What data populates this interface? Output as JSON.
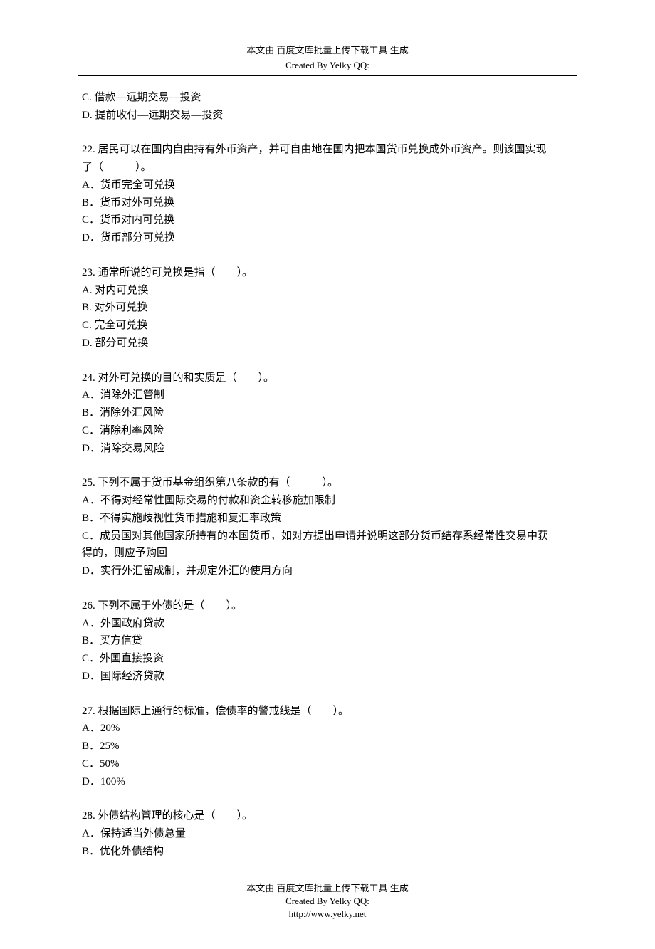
{
  "header": {
    "line1": "本文由  百度文库批量上传下载工具  生成",
    "line2": "Created By Yelky QQ:"
  },
  "prev": {
    "optC": "C. 借款—远期交易—投资",
    "optD": "D. 提前收付—远期交易—投资"
  },
  "q22": {
    "stem1": "22. 居民可以在国内自由持有外币资产，并可自由地在国内把本国货币兑换成外币资产。则该国实现",
    "stem2": "了（　　　）。",
    "a": "A．货币完全可兑换",
    "b": "B．货币对外可兑换",
    "c": "C．货币对内可兑换",
    "d": "D．货币部分可兑换"
  },
  "q23": {
    "stem": "23. 通常所说的可兑换是指（　　）。",
    "a": "A. 对内可兑换",
    "b": "B. 对外可兑换",
    "c": "C. 完全可兑换",
    "d": "D. 部分可兑换"
  },
  "q24": {
    "stem": "24. 对外可兑换的目的和实质是（　　）。",
    "a": "A．消除外汇管制",
    "b": "B．消除外汇风险",
    "c": "C．消除利率风险",
    "d": "D．消除交易风险"
  },
  "q25": {
    "stem": "25. 下列不属于货币基金组织第八条款的有（　　　）。",
    "a": "A．不得对经常性国际交易的付款和资金转移施加限制",
    "b": "B．不得实施歧视性货币措施和复汇率政策",
    "c1": "C．成员国对其他国家所持有的本国货币，如对方提出申请并说明这部分货币结存系经常性交易中获",
    "c2": "得的，则应予购回",
    "d": "D．实行外汇留成制，并规定外汇的使用方向"
  },
  "q26": {
    "stem": "26. 下列不属于外债的是（　　）。",
    "a": "A．外国政府贷款",
    "b": "B．买方信贷",
    "c": "C．外国直接投资",
    "d": "D．国际经济贷款"
  },
  "q27": {
    "stem": "27. 根据国际上通行的标准，偿债率的警戒线是（　　）。",
    "a": "A．20%",
    "b": "B．25%",
    "c": "C．50%",
    "d": "D．100%"
  },
  "q28": {
    "stem": "28. 外债结构管理的核心是（　　）。",
    "a": "A．保持适当外债总量",
    "b": "B．优化外债结构"
  },
  "footer": {
    "line1": "本文由  百度文库批量上传下载工具  生成",
    "line2": "Created By Yelky QQ:",
    "line3": "http://www.yelky.net"
  }
}
